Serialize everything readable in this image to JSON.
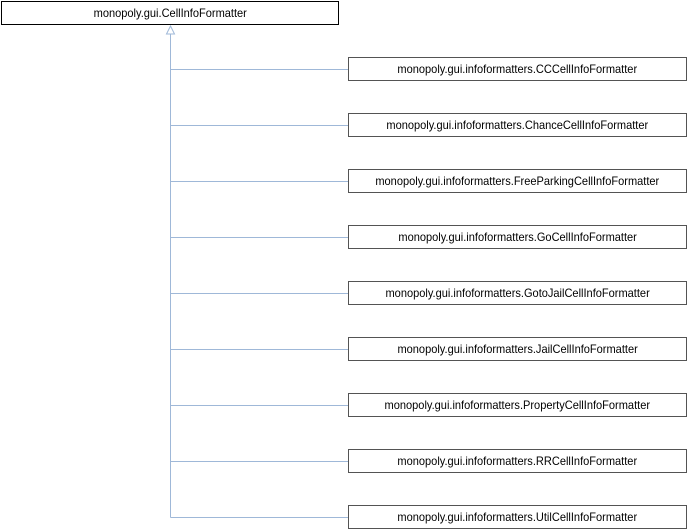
{
  "base_class": {
    "name": "monopoly.gui.CellInfoFormatter"
  },
  "derived_classes": [
    {
      "name": "monopoly.gui.infoformatters.CCCellInfoFormatter"
    },
    {
      "name": "monopoly.gui.infoformatters.ChanceCellInfoFormatter"
    },
    {
      "name": "monopoly.gui.infoformatters.FreeParkingCellInfoFormatter"
    },
    {
      "name": "monopoly.gui.infoformatters.GoCellInfoFormatter"
    },
    {
      "name": "monopoly.gui.infoformatters.GotoJailCellInfoFormatter"
    },
    {
      "name": "monopoly.gui.infoformatters.JailCellInfoFormatter"
    },
    {
      "name": "monopoly.gui.infoformatters.PropertyCellInfoFormatter"
    },
    {
      "name": "monopoly.gui.infoformatters.RRCellInfoFormatter"
    },
    {
      "name": "monopoly.gui.infoformatters.UtilCellInfoFormatter"
    }
  ],
  "colors": {
    "edge": "#9fb8d8",
    "node_border": "#545454",
    "base_border": "#000000"
  }
}
